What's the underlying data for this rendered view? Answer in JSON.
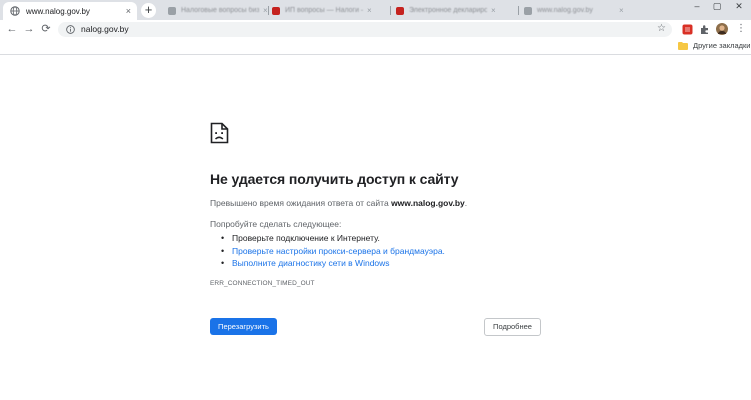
{
  "browser": {
    "active_tab": {
      "title": "www.nalog.gov.by",
      "close": "×"
    },
    "new_tab": "+",
    "background_tabs": [
      {
        "title": "Налоговые вопросы бизнеса",
        "close": "×",
        "color": "#5f6368"
      },
      {
        "title": "ИП вопросы — Налоги — Сайты",
        "close": "×",
        "color": "#c5221f"
      },
      {
        "title": "Электронное декларирование",
        "close": "×",
        "color": "#c5221f"
      },
      {
        "title": "www.nalog.gov.by",
        "close": "×",
        "color": "#5f6368"
      }
    ],
    "window_controls": {
      "minimize": "–",
      "maximize": "▢",
      "close": "✕"
    },
    "nav": {
      "back": "←",
      "forward": "→",
      "reload": "⟳"
    },
    "address": {
      "url": "nalog.gov.by",
      "star": "☆"
    },
    "menu": "⋮",
    "bookmarks": {
      "other_label": "Другие закладки"
    },
    "icons": {
      "site_info": "info-icon",
      "extension_1": "red-extension-icon",
      "extension_2": "puzzle-icon",
      "profile": "avatar"
    }
  },
  "error": {
    "title": "Не удается получить доступ к сайту",
    "summary_prefix": "Превышено время ожидания ответа от сайта ",
    "summary_host": "www.nalog.gov.by",
    "summary_suffix": ".",
    "suggest_heading": "Попробуйте сделать следующее:",
    "suggestions": [
      {
        "text": "Проверьте подключение к Интернету.",
        "kind": "plain"
      },
      {
        "text": "Проверьте настройки прокси-сервера и брандмауэра.",
        "kind": "link"
      },
      {
        "text": "Выполните диагностику сети в Windows",
        "kind": "link"
      }
    ],
    "code": "ERR_CONNECTION_TIMED_OUT",
    "reload_label": "Перезагрузить",
    "details_label": "Подробнее"
  },
  "colors": {
    "accent": "#1a73e8",
    "tabstrip": "#dee1e6",
    "omnibox": "#f1f3f4",
    "title_text": "#202124",
    "secondary_text": "#5f6368"
  }
}
